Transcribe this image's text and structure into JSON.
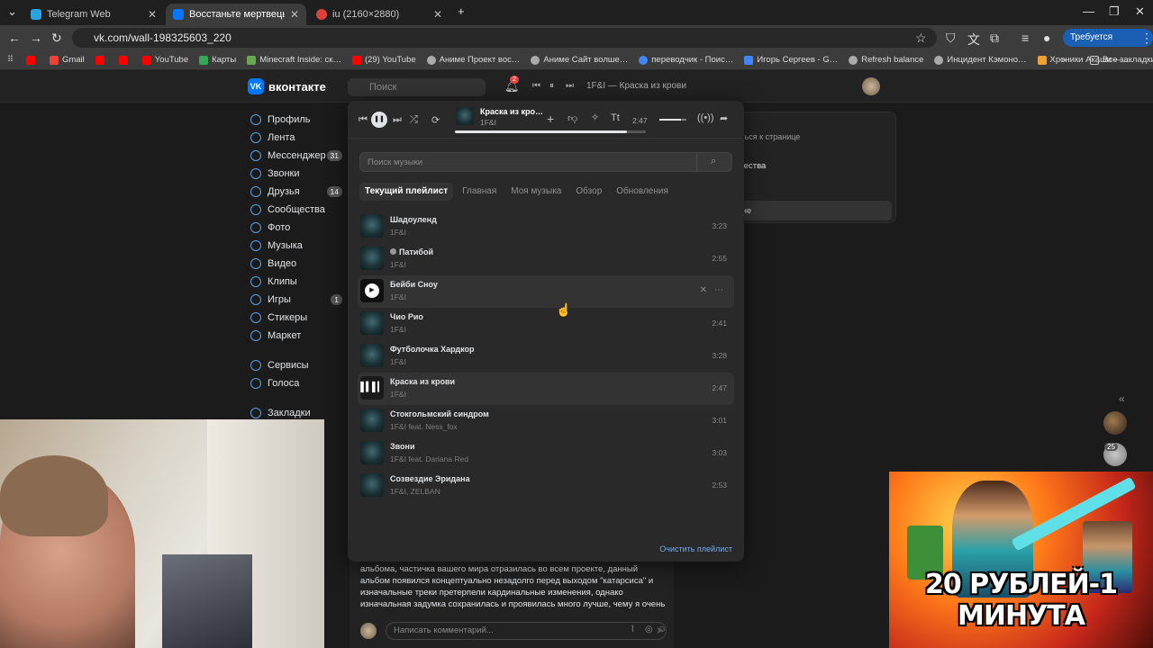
{
  "browser": {
    "tabs": [
      {
        "label": "Telegram Web",
        "active": false,
        "color": "#2aa3e0"
      },
      {
        "label": "Восстаньте мертвецы! Вы…",
        "active": true,
        "color": "#0077ff"
      },
      {
        "label": "iu (2160×2880)",
        "active": false,
        "color": "#e0403c"
      }
    ],
    "new_tab": "+",
    "url": "vk.com/wall-198325603_220",
    "action_label": "Требуется действие",
    "bookmarks": [
      {
        "label": "",
        "color": "#ff0000"
      },
      {
        "label": "Gmail",
        "color": "#ea4335"
      },
      {
        "label": "",
        "color": "#ff0000"
      },
      {
        "label": "",
        "color": "#ff0000"
      },
      {
        "label": "YouTube",
        "color": "#ff0000"
      },
      {
        "label": "Карты",
        "color": "#34a853"
      },
      {
        "label": "Minecraft Inside: ск…",
        "color": "#6aa84f"
      },
      {
        "label": "(29) YouTube",
        "color": "#ff0000"
      },
      {
        "label": "Аниме Проект вос…",
        "color": "#aaaaaa"
      },
      {
        "label": "Аниме Сайт волше…",
        "color": "#aaaaaa"
      },
      {
        "label": "переводчик - Поис…",
        "color": "#4285f4"
      },
      {
        "label": "Игорь Сергеев - G…",
        "color": "#4285f4"
      },
      {
        "label": "Refresh balance",
        "color": "#aaaaaa"
      },
      {
        "label": "Инцидент Кэмоно…",
        "color": "#aaaaaa"
      },
      {
        "label": "Хроники Акаши —…",
        "color": "#f0a030"
      }
    ],
    "all_bookmarks": "Все закладки"
  },
  "vk": {
    "logo": "вконтакте",
    "search_placeholder": "Поиск",
    "notif_count": "2",
    "header_track": "1F&I — Краска из крови",
    "sidebar": [
      {
        "label": "Профиль",
        "count": ""
      },
      {
        "label": "Лента",
        "count": ""
      },
      {
        "label": "Мессенджер",
        "count": "31"
      },
      {
        "label": "Звонки",
        "count": ""
      },
      {
        "label": "Друзья",
        "count": "14"
      },
      {
        "label": "Сообщества",
        "count": ""
      },
      {
        "label": "Фото",
        "count": ""
      },
      {
        "label": "Музыка",
        "count": ""
      },
      {
        "label": "Видео",
        "count": ""
      },
      {
        "label": "Клипы",
        "count": ""
      },
      {
        "label": "Игры",
        "count": "1"
      },
      {
        "label": "Стикеры",
        "count": ""
      },
      {
        "label": "Маркет",
        "count": ""
      },
      {
        "label": "Сервисы",
        "count": ""
      },
      {
        "label": "Голоса",
        "count": ""
      },
      {
        "label": "Закладки",
        "count": ""
      }
    ],
    "right_card": {
      "line1": "уться к странице",
      "line2": "щества",
      "line3": "не"
    },
    "post_text": "альбома, частичка вашего мира отразилась во всем проекте, данный альбом появился концептуально незадолго перед выходом \"катарсиса\" и изначальные треки претерпели кардинальные изменения, однако изначальная задумка сохранилась и проявилась много лучше, чему я очень",
    "comment_placeholder": "Написать комментарий..."
  },
  "player": {
    "now_title": "Краска из кро…",
    "now_artist": "1F&I",
    "time": "2:47",
    "progress": 0.9,
    "search_placeholder": "Поиск музыки",
    "tabs": [
      "Текущий плейлист",
      "Главная",
      "Моя музыка",
      "Обзор",
      "Обновления"
    ],
    "tracks": [
      {
        "title": "Шадоуленд",
        "artist": "1F&I",
        "duration": "3:23"
      },
      {
        "title": "Патибой",
        "artist": "1F&I",
        "duration": "2:55"
      },
      {
        "title": "Бейби Сноу",
        "artist": "1F&I",
        "duration": ""
      },
      {
        "title": "Чио Рио",
        "artist": "1F&I",
        "duration": "2:41"
      },
      {
        "title": "Футболочка Хардкор",
        "artist": "1F&I",
        "duration": "3:28"
      },
      {
        "title": "Краска из крови",
        "artist": "1F&I",
        "duration": "2:47"
      },
      {
        "title": "Стокгольмский синдром",
        "artist": "1F&I feat. Ness_fox",
        "duration": "3:01"
      },
      {
        "title": "Звони",
        "artist": "1F&I feat. Dariana Red",
        "duration": "3:03"
      },
      {
        "title": "Созвездие Эридана",
        "artist": "1F&I, ZELBAN",
        "duration": "2:53"
      }
    ],
    "clear_label": "Очистить плейлист"
  },
  "overlay": {
    "thumbnail_text": "20 РУБЛЕЙ-1 МИНУТА",
    "avatar_badge": "25"
  }
}
